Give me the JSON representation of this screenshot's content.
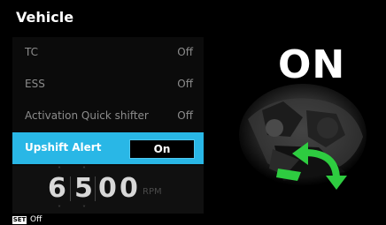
{
  "header": {
    "title": "Vehicle"
  },
  "menu": {
    "items": [
      {
        "label": "TC",
        "value": "Off"
      },
      {
        "label": "ESS",
        "value": "Off"
      },
      {
        "label": "Activation Quick shifter",
        "value": "Off"
      },
      {
        "label": "Upshift Alert",
        "value": "On"
      }
    ]
  },
  "rpm": {
    "digits": [
      "6",
      "5",
      "0",
      "0"
    ],
    "unit": "RPM"
  },
  "footer": {
    "key_label": "SET",
    "value": "Off"
  },
  "preview": {
    "status": "ON",
    "icon": "quick-shifter-pedal-arrow-icon"
  },
  "colors": {
    "accent": "#29b7e6",
    "arrow": "#2ecc40",
    "background": "#000000"
  }
}
